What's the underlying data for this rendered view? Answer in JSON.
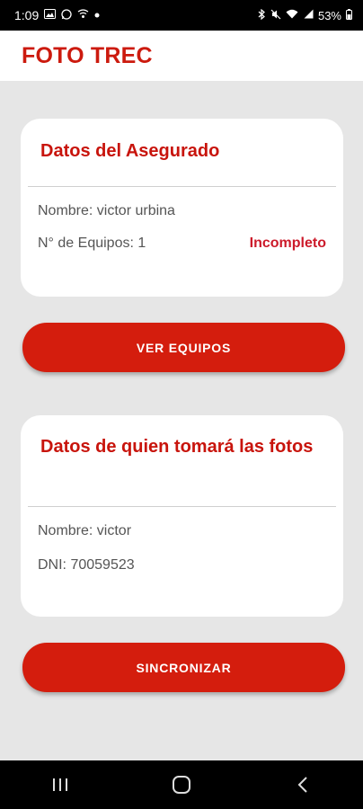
{
  "status_bar": {
    "time": "1:09",
    "battery": "53%"
  },
  "app": {
    "title": "FOTO TREC"
  },
  "insured_card": {
    "title": "Datos del Asegurado",
    "name_line": "Nombre: victor urbina",
    "equipment_line": "N° de Equipos: 1",
    "status": "Incompleto"
  },
  "view_equipment_button": {
    "label": "VER EQUIPOS"
  },
  "photographer_card": {
    "title": "Datos de quien tomará las fotos",
    "name_line": "Nombre: victor",
    "dni_line": "DNI: 70059523"
  },
  "sync_button": {
    "label": "SINCRONIZAR"
  },
  "colors": {
    "brand_red": "#d41d0d",
    "status_red": "#cc1a2a",
    "background": "#e6e6e6"
  },
  "icons": {
    "status_left": [
      "gallery-icon",
      "whatsapp-icon",
      "wifi-calling-icon",
      "dot-icon"
    ],
    "status_right": [
      "bluetooth-icon",
      "mute-icon",
      "wifi-icon",
      "signal-icon",
      "battery-icon"
    ],
    "nav": [
      "recents-icon",
      "home-icon",
      "back-icon"
    ]
  }
}
